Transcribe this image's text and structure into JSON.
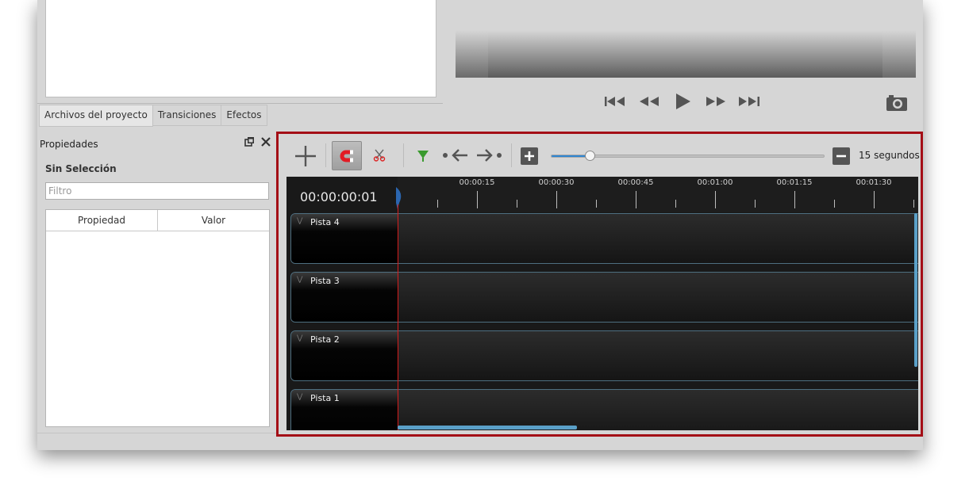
{
  "tabs": [
    "Archivos del proyecto",
    "Transiciones",
    "Efectos"
  ],
  "properties": {
    "title": "Propiedades",
    "float_icon": "float-icon",
    "close_icon": "close-icon",
    "selection": "Sin Selección",
    "filter_placeholder": "Filtro",
    "col_property": "Propiedad",
    "col_value": "Valor"
  },
  "playback": [
    "jump-start-icon",
    "rewind-icon",
    "play-icon",
    "fast-forward-icon",
    "jump-end-icon",
    "camera-icon"
  ],
  "timeline": {
    "zoom_label": "15 segundos",
    "zoom_level": 0.14,
    "timecode": "00:00:00:01",
    "ruler_labels": [
      "00:00:15",
      "00:00:30",
      "00:00:45",
      "00:01:00",
      "00:01:15",
      "00:01:30"
    ],
    "tracks": [
      "Pista 4",
      "Pista 3",
      "Pista 2",
      "Pista 1"
    ],
    "accent_color": "#a40e16"
  }
}
